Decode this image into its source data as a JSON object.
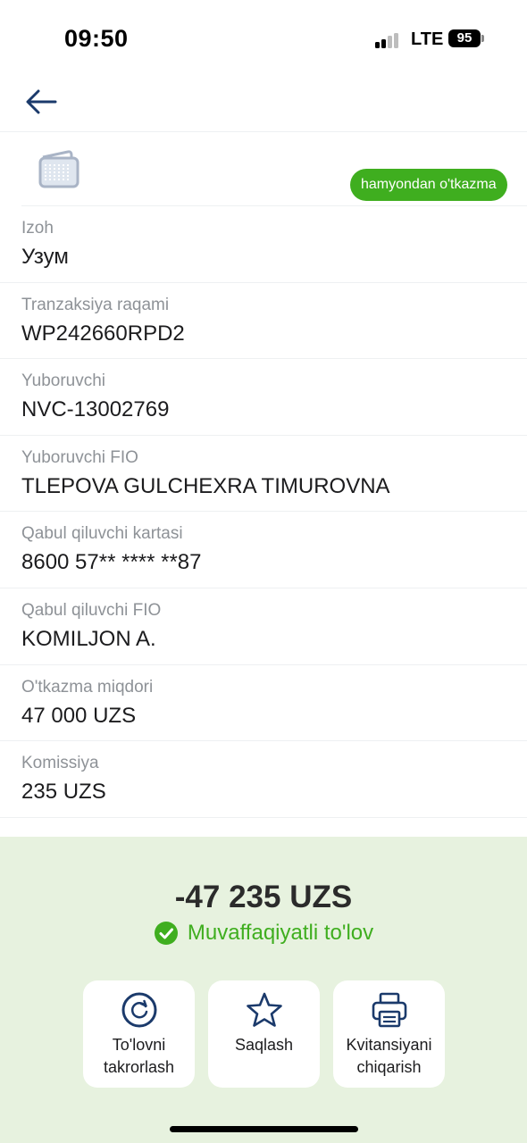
{
  "status_bar": {
    "time": "09:50",
    "network": "LTE",
    "battery": "95"
  },
  "header": {
    "back_icon": "arrow-left-icon"
  },
  "transfer": {
    "wallet_icon": "wallet-icon",
    "type_badge": "hamyondan o'tkazma"
  },
  "details": [
    {
      "label": "Izoh",
      "value": "Узум"
    },
    {
      "label": "Tranzaksiya raqami",
      "value": "WP242660RPD2"
    },
    {
      "label": "Yuboruvchi",
      "value": "NVC-13002769"
    },
    {
      "label": "Yuboruvchi FIO",
      "value": "TLEPOVA GULCHEXRA TIMUROVNA"
    },
    {
      "label": "Qabul qiluvchi kartasi",
      "value": "8600 57** **** **87"
    },
    {
      "label": "Qabul qiluvchi FIO",
      "value": "KOMILJON A."
    },
    {
      "label": "O'tkazma miqdori",
      "value": "47 000 UZS"
    },
    {
      "label": "Komissiya",
      "value": "235 UZS"
    }
  ],
  "summary": {
    "total": "-47 235 UZS",
    "status": "Muvaffaqiyatli to'lov",
    "status_color": "#3fae1f"
  },
  "actions": [
    {
      "label_1": "To'lovni",
      "label_2": "takrorlash",
      "icon": "repeat-icon"
    },
    {
      "label_1": "Saqlash",
      "label_2": "",
      "icon": "star-icon"
    },
    {
      "label_1": "Kvitansiyani",
      "label_2": "chiqarish",
      "icon": "printer-icon"
    }
  ],
  "colors": {
    "accent": "#1b3a6b",
    "success": "#3fae1f",
    "panel_bg": "#e7f2df"
  }
}
